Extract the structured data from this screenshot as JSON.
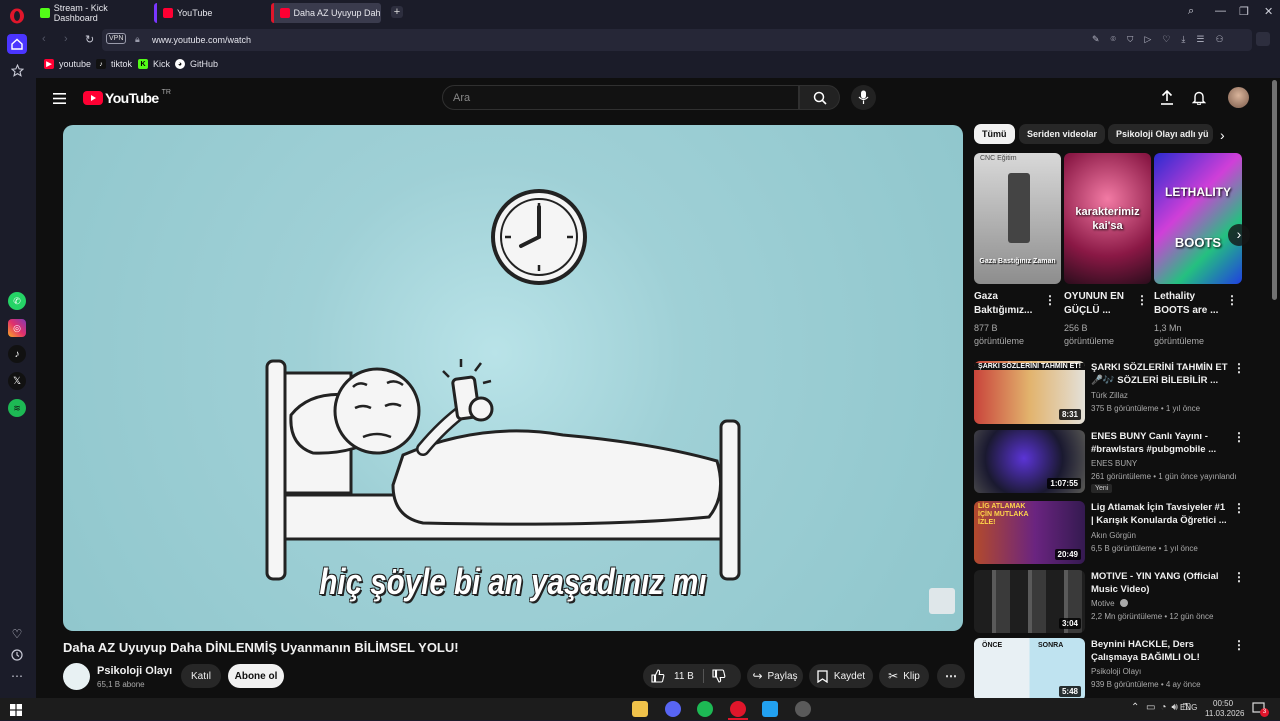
{
  "browser": {
    "tabs": [
      {
        "label": "Stream - Kick Dashboard"
      },
      {
        "label": "YouTube"
      },
      {
        "label": "Daha AZ Uyuyup Daha Di"
      }
    ],
    "vpn_badge": "VPN",
    "url": "www.youtube.com/watch",
    "bookmarks": [
      {
        "label": "youtube"
      },
      {
        "label": "tiktok"
      },
      {
        "label": "Kick"
      },
      {
        "label": "GitHub"
      }
    ]
  },
  "youtube": {
    "logo": "YouTube",
    "region": "TR",
    "search_placeholder": "Ara"
  },
  "video": {
    "subtitle": "hiç şöyle bi an yaşadınız mı",
    "title": "Daha AZ Uyuyup Daha DİNLENMİŞ Uyanmanın BİLİMSEL YOLU!",
    "channel": "Psikoloji Olayı",
    "subscribers": "65,1 B abone",
    "join_label": "Katıl",
    "subscribe_label": "Abone ol",
    "likes": "11 B",
    "share_label": "Paylaş",
    "save_label": "Kaydet",
    "clip_label": "Klip"
  },
  "chips": [
    "Tümü",
    "Seriden videolar",
    "Psikoloji Olayı adlı yü"
  ],
  "shelf": [
    {
      "thumb_top": "CNC Eğitim",
      "thumb_caption": "Gaza Bastığınız Zaman",
      "title": "Gaza Baktığımız...",
      "views": "877 B",
      "views_label": "görüntüleme"
    },
    {
      "thumb_caption": "karakterimiz kai'sa",
      "title": "OYUNUN EN GÜÇLÜ ...",
      "views": "256 B",
      "views_label": "görüntüleme"
    },
    {
      "thumb_top": "LETHALITY",
      "thumb_caption": "BOOTS",
      "title": "Lethality BOOTS are ...",
      "views": "1,3 Mn",
      "views_label": "görüntüleme"
    }
  ],
  "recommendations": [
    {
      "title": "ŞARKI SÖZLERİNİ TAHMİN ET 🎤🎶 SÖZLERİ BİLEBİLİR ...",
      "thumb_text": "ŞARKI SÖZLERİNİ TAHMİN ET!",
      "channel": "Türk Zillaz",
      "meta": "375 B görüntüleme • 1 yıl önce",
      "duration": "8:31"
    },
    {
      "title": "ENES   BUNY Canlı Yayını - #brawlstars  #pubgmobile  ...",
      "channel": "ENES BUNY",
      "meta": "261 görüntüleme • 1 gün önce yayınlandı",
      "badge": "Yeni",
      "duration": "1:07:55"
    },
    {
      "title": "Lig Atlamak İçin Tavsiyeler #1 | Karışık Konularda Öğretici ...",
      "thumb_text": "LİG ATLAMAK İÇİN MUTLAKA İZLE!",
      "channel": "Akın Görgün",
      "meta": "6,5 B görüntüleme • 1 yıl önce",
      "duration": "20:49"
    },
    {
      "title": "MOTIVE - YIN YANG (Official Music Video)",
      "channel": "Motive",
      "meta": "2,2 Mn görüntüleme • 12 gün önce",
      "duration": "3:04"
    },
    {
      "title": "Beynini HACKLE, Ders Çalışmaya BAĞIMLI OL!",
      "thumb_left": "ÖNCE",
      "thumb_right": "SONRA",
      "channel": "Psikoloji Olayı",
      "meta": "939 B görüntüleme • 4 ay önce",
      "duration": "5:48"
    }
  ],
  "taskbar": {
    "language": "ENG",
    "time": "00:50",
    "date": "11.03.2026",
    "notifications": "3"
  },
  "colors": {
    "opera_red": "#e0162b",
    "youtube_red": "#ff0033",
    "browser_bg": "#1b1c29",
    "page_bg": "#0f0f0f",
    "video_bg": "#9fd0d6"
  }
}
